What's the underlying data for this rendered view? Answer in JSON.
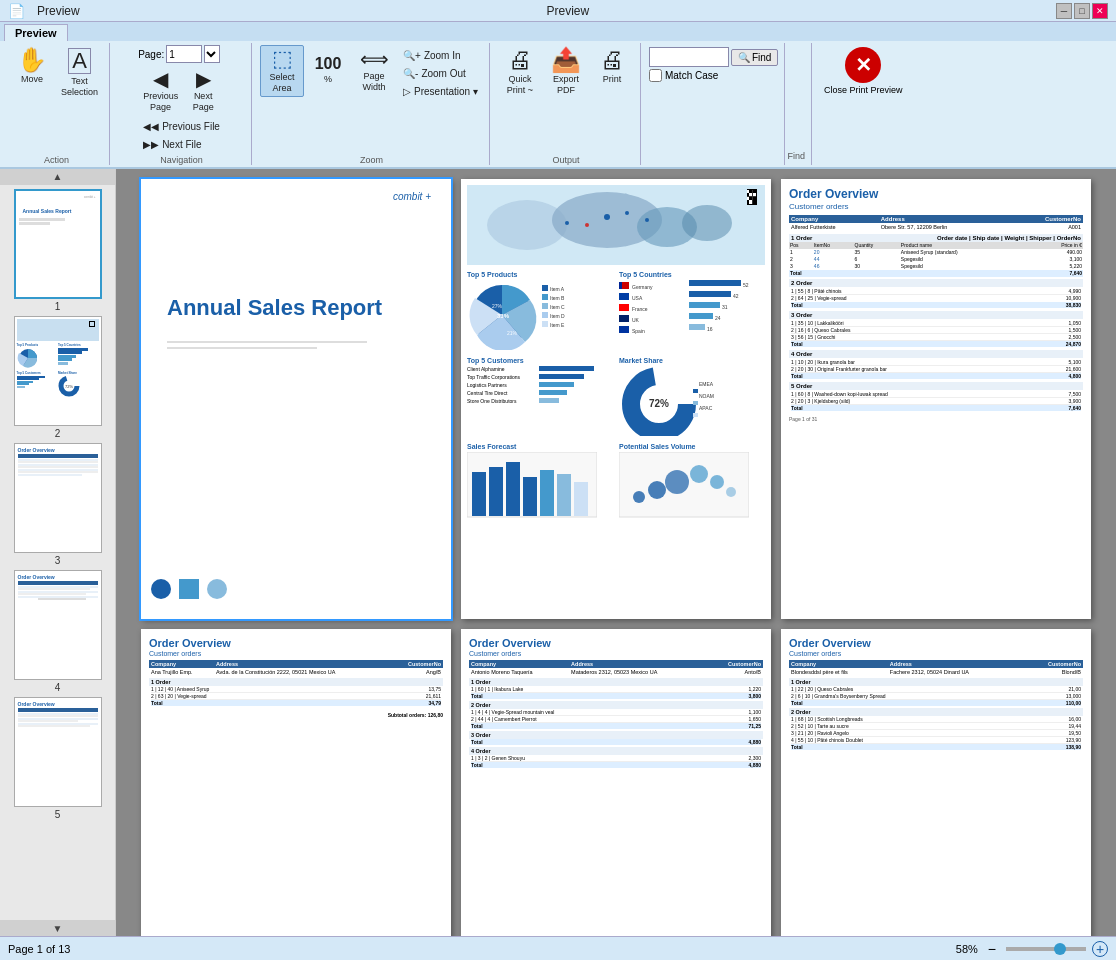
{
  "titlebar": {
    "title": "Preview",
    "controls": [
      "minimize",
      "maximize",
      "close"
    ]
  },
  "ribbon": {
    "tabs": [
      "Preview"
    ],
    "active_tab": "Preview",
    "groups": {
      "action": {
        "label": "Action",
        "buttons": [
          {
            "id": "move",
            "icon": "✋",
            "label": "Move"
          },
          {
            "id": "text-selection",
            "icon": "𝐓",
            "label": "Text Selection"
          }
        ]
      },
      "navigation": {
        "label": "Navigation",
        "page_label": "Page:",
        "page_value": "1",
        "buttons": [
          {
            "id": "previous-page",
            "icon": "◀",
            "label": "Previous\nPage"
          },
          {
            "id": "next-page",
            "icon": "▶",
            "label": "Next\nPage"
          },
          {
            "id": "previous-file",
            "label": "Previous File"
          },
          {
            "id": "next-file",
            "label": "Next File"
          }
        ]
      },
      "zoom": {
        "label": "Zoom",
        "buttons": [
          {
            "id": "select-area",
            "label": "Select\nArea"
          },
          {
            "id": "zoom-100",
            "label": "100"
          },
          {
            "id": "page-width",
            "label": "Page\nWidth"
          }
        ],
        "zoom_options": [
          {
            "id": "zoom-in",
            "label": "Zoom In"
          },
          {
            "id": "zoom-out",
            "label": "Zoom Out"
          },
          {
            "id": "presentation",
            "label": "Presentation"
          }
        ]
      },
      "output": {
        "label": "Output",
        "buttons": [
          {
            "id": "quick-print",
            "label": "Quick\nPrint ~"
          },
          {
            "id": "export-pdf",
            "label": "Export\nPDF"
          },
          {
            "id": "print",
            "label": "Print"
          }
        ]
      },
      "find": {
        "label": "Find",
        "input_placeholder": "",
        "find_label": "Find",
        "match_case_label": "Match Case"
      },
      "close": {
        "label": "Close Print Preview"
      }
    }
  },
  "sidebar": {
    "pages": [
      {
        "num": 1,
        "label": "1",
        "type": "annual"
      },
      {
        "num": 2,
        "label": "2",
        "type": "dashboard"
      },
      {
        "num": 3,
        "label": "3",
        "type": "orders"
      },
      {
        "num": 4,
        "label": "4",
        "type": "orders"
      },
      {
        "num": 5,
        "label": "5",
        "type": "orders"
      }
    ]
  },
  "preview": {
    "pages_row1": [
      {
        "type": "annual",
        "selected": true
      },
      {
        "type": "dashboard",
        "selected": false
      },
      {
        "type": "orders-right",
        "selected": false
      }
    ],
    "pages_row2": [
      {
        "type": "orders-sm",
        "selected": false
      },
      {
        "type": "orders-sm2",
        "selected": false
      },
      {
        "type": "orders-sm3",
        "selected": false
      }
    ]
  },
  "statusbar": {
    "page_info": "Page 1 of 13",
    "zoom_percent": "58%",
    "zoom_minus": "−",
    "zoom_plus": "+"
  },
  "pages": {
    "annual": {
      "title": "Annual Sales Report",
      "logo": "combit +"
    },
    "orders": {
      "title": "Order Overview",
      "subtitle": "Customer orders",
      "headers": [
        "Company",
        "Address",
        "CustomerNo"
      ],
      "order_headers": [
        "Order",
        "Order date",
        "Ship date",
        "Weight",
        "Shipper",
        "OrderNo"
      ],
      "pos_headers": [
        "Pos",
        "ItemNo",
        "Quantity",
        "Product name",
        "Price in €"
      ]
    },
    "dashboard": {
      "sections": [
        "Top 5 Products",
        "Top 5 Countries",
        "Top 5 Customers",
        "Market Share",
        "Sales Forecast",
        "Potential Sales Volume"
      ]
    }
  }
}
